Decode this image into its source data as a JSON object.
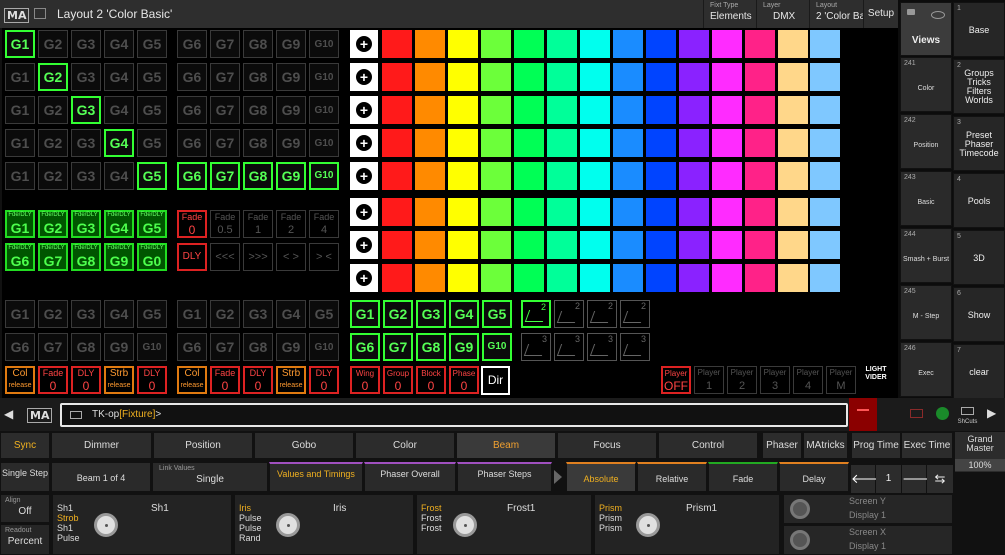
{
  "titlebar": {
    "logo": "MA",
    "title": "Layout 2 'Color Basic'",
    "fixture_type": {
      "k": "Fixt Type",
      "v": "Elements"
    },
    "layer": {
      "k": "Layer",
      "v": "DMX"
    },
    "layout": {
      "k": "Layout",
      "v": "2 'Color Bas"
    },
    "setup": "Setup"
  },
  "groups": {
    "g_labels": [
      "G1",
      "G2",
      "G3",
      "G4",
      "G5"
    ],
    "g2_labels": [
      "G6",
      "G7",
      "G8",
      "G9",
      "G10"
    ],
    "fdly_top": "Fde/DLY",
    "fdly_row1": [
      "G1",
      "G2",
      "G3",
      "G4",
      "G5"
    ],
    "fdly_row2": [
      "G6",
      "G7",
      "G8",
      "G9",
      "G0"
    ],
    "fade_red": {
      "t": "Fade",
      "b": "0"
    },
    "fade_gray": [
      {
        "t": "Fade",
        "b": "0.5"
      },
      {
        "t": "Fade",
        "b": "1"
      },
      {
        "t": "Fade",
        "b": "2"
      },
      {
        "t": "Fade",
        "b": "4"
      }
    ],
    "dly_label": "DLY",
    "dir_gray": [
      "<<<",
      ">>>",
      "< >",
      "> <"
    ],
    "g_lower1": [
      "G1",
      "G2",
      "G3",
      "G4",
      "G5"
    ],
    "g_lower2": [
      "G6",
      "G7",
      "G8",
      "G9",
      "G10"
    ]
  },
  "bottom_left": [
    {
      "t": "Col",
      "b": "release",
      "c": "org"
    },
    {
      "t": "Fade",
      "b": "0",
      "c": "red"
    },
    {
      "t": "DLY",
      "b": "0",
      "c": "red"
    },
    {
      "t": "Strb",
      "b": "release",
      "c": "org"
    },
    {
      "t": "DLY",
      "b": "0",
      "c": "red"
    }
  ],
  "bottom_mid": [
    {
      "t": "Col",
      "b": "release",
      "c": "org"
    },
    {
      "t": "Fade",
      "b": "0",
      "c": "red"
    },
    {
      "t": "DLY",
      "b": "0",
      "c": "red"
    },
    {
      "t": "Strb",
      "b": "release",
      "c": "org"
    },
    {
      "t": "DLY",
      "b": "0",
      "c": "red"
    }
  ],
  "bottom_right": [
    {
      "t": "Wing",
      "b": "0"
    },
    {
      "t": "Group",
      "b": "0"
    },
    {
      "t": "Block",
      "b": "0"
    },
    {
      "t": "Phase",
      "b": "0"
    }
  ],
  "dir_label": "Dir",
  "players": [
    {
      "t": "Player",
      "b": "OFF",
      "on": true
    },
    {
      "t": "Player",
      "b": "1"
    },
    {
      "t": "Player",
      "b": "2"
    },
    {
      "t": "Player",
      "b": "3"
    },
    {
      "t": "Player",
      "b": "4"
    },
    {
      "t": "Player",
      "b": "M"
    }
  ],
  "lightvider": "LIGHT VIDER",
  "phasers": [
    "2",
    "2",
    "2",
    "2",
    "3",
    "3",
    "3",
    "3"
  ],
  "color_palette": [
    "#ff1a1a",
    "#ff8a00",
    "#ffff00",
    "#6cff3a",
    "#00ff55",
    "#00ff99",
    "#00ffee",
    "#1a8cff",
    "#0044ff",
    "#8a22ff",
    "#ff2bff",
    "#ff2288",
    "#ffd78a",
    "#7fc8ff"
  ],
  "views": {
    "label": "Views",
    "items": [
      {
        "n": "241",
        "l": "Color"
      },
      {
        "n": "242",
        "l": "Position"
      },
      {
        "n": "243",
        "l": "Basic"
      },
      {
        "n": "244",
        "l": "Smash + Burst"
      },
      {
        "n": "245",
        "l": "M - Step"
      },
      {
        "n": "246",
        "l": "Exec"
      }
    ]
  },
  "presets": [
    {
      "n": "1",
      "l": "Base"
    },
    {
      "n": "2",
      "l": "Groups Tricks Filters Worlds"
    },
    {
      "n": "3",
      "l": "Preset Phaser Timecode"
    },
    {
      "n": "4",
      "l": "Pools"
    },
    {
      "n": "5",
      "l": "3D"
    },
    {
      "n": "6",
      "l": "Show"
    },
    {
      "n": "7",
      "l": "clear"
    }
  ],
  "cmdline": {
    "prompt": "TK-op",
    "bracket": "[Fixture]",
    "tail": ">",
    "shcuts": "ShCuts"
  },
  "tabs": {
    "sync": "Sync",
    "dimmer": "Dimmer",
    "position": "Position",
    "gobo": "Gobo",
    "color": "Color",
    "beam": "Beam",
    "focus": "Focus",
    "control": "Control",
    "phaser": "Phaser",
    "matricks": "MAtricks",
    "prog_time": "Prog Time",
    "exec_time": "Exec Time",
    "grand": "Grand Master",
    "grand_val": "100%"
  },
  "row2": {
    "single_step": "Single Step",
    "beam_of": "Beam 1 of 4",
    "link_k": "Link Values",
    "link_v": "Single",
    "values_timings": "Values and Timings",
    "phaser_overall": "Phaser Overall",
    "phaser_steps": "Phaser Steps",
    "absolute": "Absolute",
    "relative": "Relative",
    "fade": "Fade",
    "delay": "Delay",
    "step": "1"
  },
  "encoders": {
    "align_k": "Align",
    "align_v": "Off",
    "readout_k": "Readout",
    "readout_v": "Percent",
    "e1": {
      "sub": [
        "Sh1",
        "Strob",
        "Sh1",
        "Pulse"
      ],
      "name": "Sh1"
    },
    "e2": {
      "sub": [
        "Iris",
        "Pulse",
        "Pulse",
        "Rand"
      ],
      "name": "Iris"
    },
    "e3": {
      "sub": [
        "Frost",
        "Frost",
        "Frost"
      ],
      "name": "Frost1"
    },
    "e4": {
      "sub": [
        "Prism",
        "Prism",
        "Prism"
      ],
      "name": "Prism1"
    },
    "screen_y": "Screen Y",
    "display1a": "Display 1",
    "screen_x": "Screen X",
    "display1b": "Display 1"
  }
}
